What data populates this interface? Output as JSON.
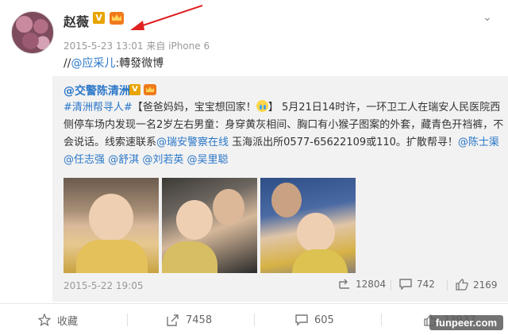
{
  "post": {
    "username": "赵薇",
    "v_badge": "V",
    "meta": "2015-5-23 13:01 来自 iPhone 6",
    "text_prefix": "//",
    "mention": "@应采儿",
    "text_suffix": ":轉發微博"
  },
  "repost": {
    "author": "@交警陈清洲",
    "v_badge": "V",
    "text": {
      "hashtag": "#清洲帮寻人#",
      "part1": "【爸爸妈妈，宝宝想回家！",
      "part2": "】 5月21日14时许，一环卫工人在瑞安人民医院西侧停车场内发现一名2岁左右男童：身穿黄灰相间、胸口有小猴子图案的外套，藏青色开裆裤，不会说话。线索速联系",
      "link1": "@瑞安警察在线",
      "part3": " 玉海派出所0577-65622109或110。扩散帮寻！",
      "link2": "@陈士渠",
      "link3": "@任志强",
      "link4": "@舒淇",
      "link5": "@刘若英",
      "link6": "@吴里聪"
    },
    "time": "2015-5-22 19:05",
    "reposts": "12804",
    "comments": "742",
    "likes": "2169"
  },
  "footer": {
    "favorite_label": "收藏",
    "repost_count": "7458",
    "comment_count": "605",
    "like_count": "23937"
  },
  "watermark": "funpeer.com",
  "colors": {
    "link": "#2a77c8",
    "v_badge": "#e8a400",
    "annotation_arrow": "#e02020"
  }
}
